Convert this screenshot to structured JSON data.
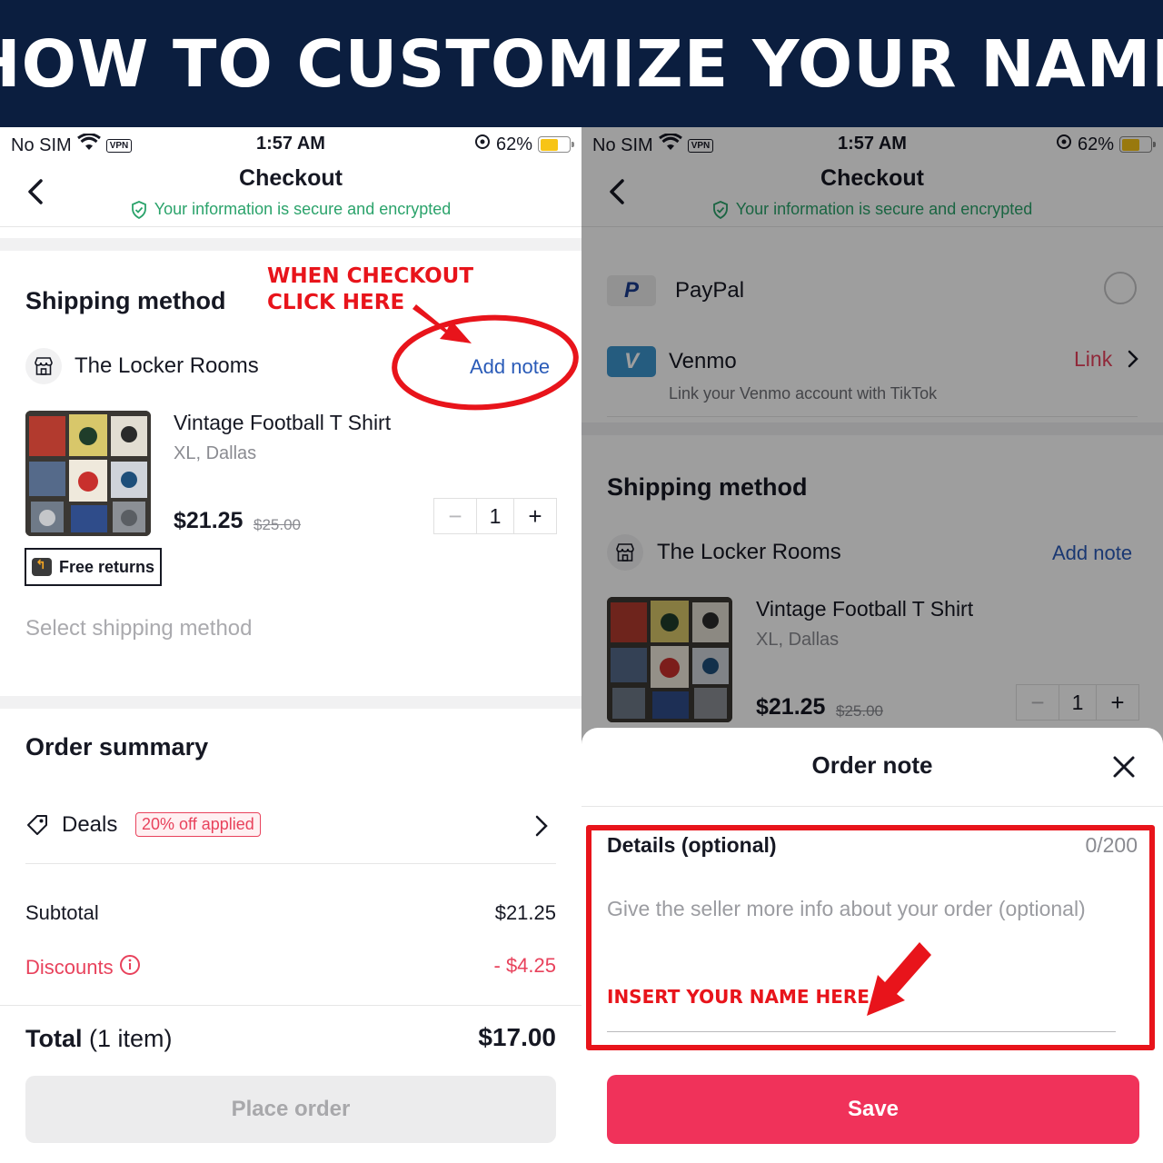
{
  "banner": {
    "title": "HOW TO CUSTOMIZE YOUR NAME"
  },
  "status_bar": {
    "carrier": "No SIM",
    "vpn": "VPN",
    "time": "1:57 AM",
    "battery": "62%",
    "battery_level": 0.62
  },
  "checkout": {
    "title": "Checkout",
    "secure_text": "Your information is secure and encrypted"
  },
  "shipping": {
    "title": "Shipping method",
    "store_name": "The Locker Rooms",
    "add_note": "Add note",
    "product": {
      "name": "Vintage Football T Shirt",
      "variant": "XL, Dallas",
      "price": "$21.25",
      "original_price": "$25.00",
      "quantity": "1",
      "minus": "−",
      "plus": "+"
    },
    "free_returns": "Free returns",
    "select_method": "Select shipping method"
  },
  "order_summary": {
    "title": "Order summary",
    "deals_label": "Deals",
    "deals_badge": "20% off applied",
    "subtotal_label": "Subtotal",
    "subtotal_value": "$21.25",
    "discounts_label": "Discounts",
    "discounts_value": "- $4.25",
    "total_label": "Total",
    "total_count": "(1 item)",
    "total_value": "$17.00",
    "place_order": "Place order"
  },
  "annotations": {
    "line1": "WHEN CHECKOUT",
    "line2": "CLICK HERE",
    "insert_name": "INSERT YOUR NAME HERE"
  },
  "payment": {
    "paypal_label": "PayPal",
    "venmo_label": "Venmo",
    "venmo_link": "Link",
    "venmo_sub": "Link your Venmo account with TikTok"
  },
  "order_note": {
    "title": "Order note",
    "details_label": "Details (optional)",
    "counter": "0/200",
    "placeholder": "Give the seller more info about your order (optional)",
    "save": "Save"
  },
  "colors": {
    "accent": "#f0325a",
    "link_blue": "#2a5bb8",
    "secure_green": "#2ba36b",
    "annotation_red": "#e8141b",
    "banner_navy": "#0b1e3f"
  }
}
